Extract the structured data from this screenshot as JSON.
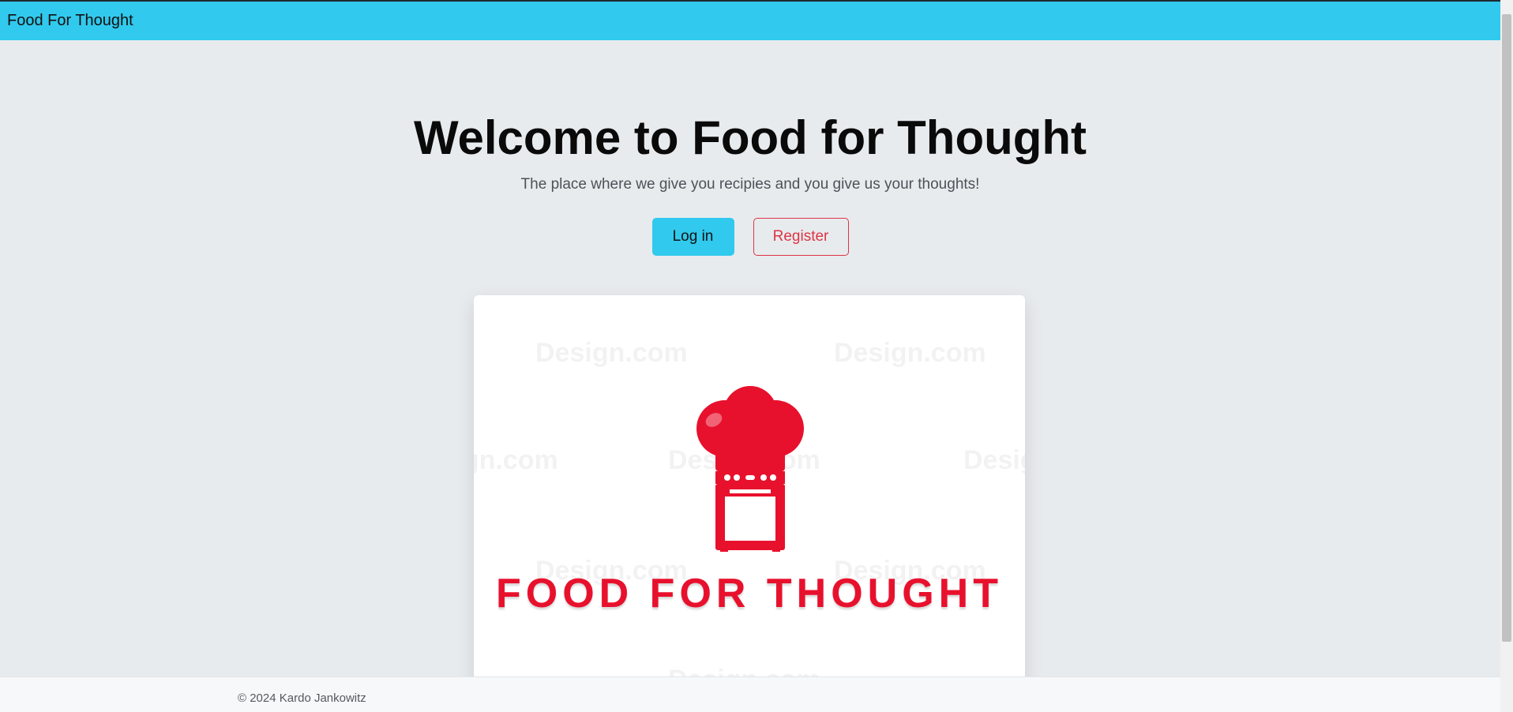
{
  "navbar": {
    "brand": "Food For Thought"
  },
  "hero": {
    "title": "Welcome to Food for Thought",
    "subtitle": "The place where we give you recipies and you give us your thoughts!"
  },
  "buttons": {
    "login": "Log in",
    "register": "Register"
  },
  "card": {
    "logo_text": "FOOD FOR THOUGHT",
    "watermark": "Design.com",
    "logo_color": "#e8112d"
  },
  "footer": {
    "copyright": "© 2024 Kardo Jankowitz"
  },
  "colors": {
    "navbar": "#31c9ed",
    "register_outline": "#dc3545",
    "background": "#e8ebee"
  }
}
